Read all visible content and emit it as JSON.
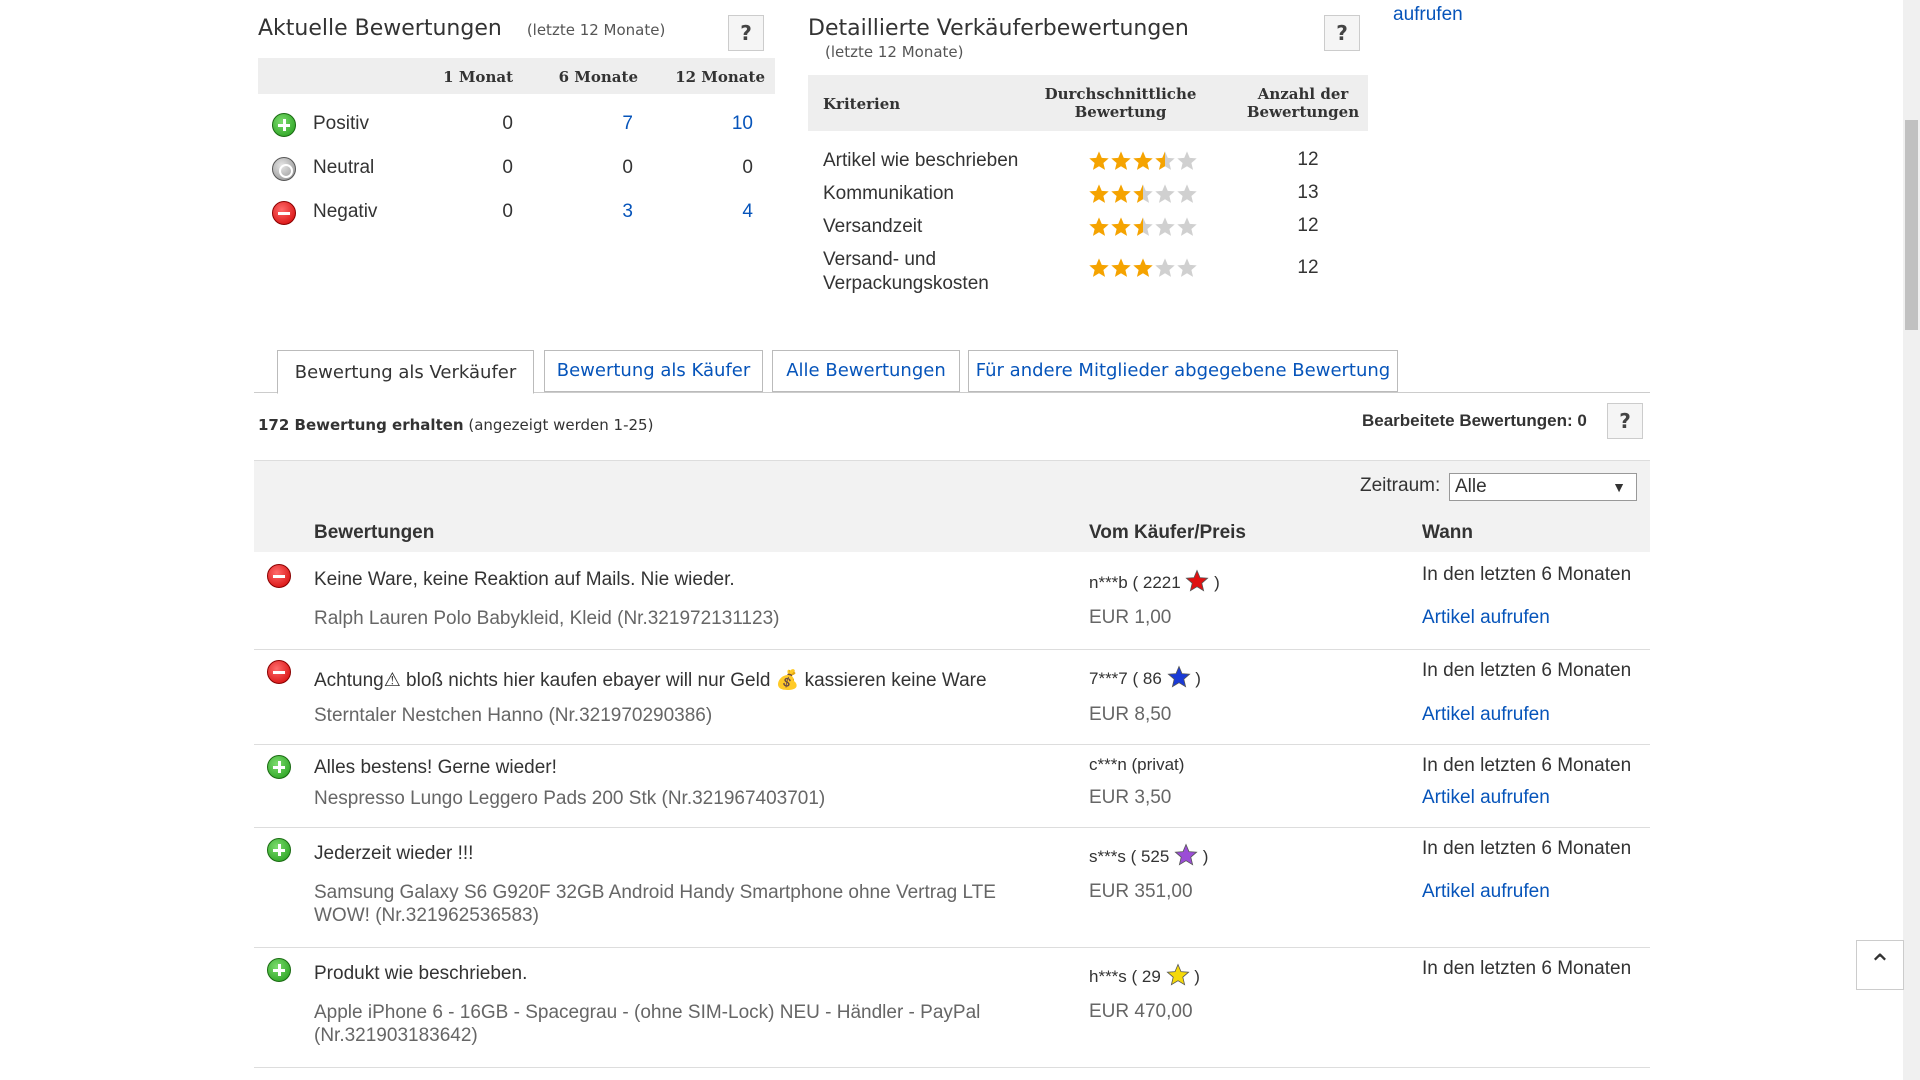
{
  "top_link": "aufrufen",
  "recent": {
    "title": "Aktuelle Bewertungen",
    "subtitle": "(letzte 12 Monate)",
    "columns": [
      "1 Monat",
      "6 Monate",
      "12 Monate"
    ],
    "rows": [
      {
        "label": "Positiv",
        "values": [
          "0",
          "7",
          "10"
        ],
        "type": "positive"
      },
      {
        "label": "Neutral",
        "values": [
          "0",
          "0",
          "0"
        ],
        "type": "neutral"
      },
      {
        "label": "Negativ",
        "values": [
          "0",
          "3",
          "4"
        ],
        "type": "negative"
      }
    ],
    "help": "?"
  },
  "detail": {
    "title": "Detaillierte Verkäuferbewertungen",
    "subtitle": "(letzte 12 Monate)",
    "head_criteria": "Kriterien",
    "head_avg": "Durchschnittliche Bewertung",
    "head_count": "Anzahl der Bewertungen",
    "rows": [
      {
        "label": "Artikel wie beschrieben",
        "rating": 3.5,
        "count": "12"
      },
      {
        "label": "Kommunikation",
        "rating": 2.5,
        "count": "13"
      },
      {
        "label": "Versandzeit",
        "rating": 2.5,
        "count": "12"
      },
      {
        "label": "Versand- und Verpackungskosten",
        "rating": 3,
        "count": "12"
      }
    ],
    "help": "?"
  },
  "tabs": [
    {
      "label": "Bewertung als Verkäufer",
      "active": true
    },
    {
      "label": "Bewertung als Käufer",
      "active": false
    },
    {
      "label": "Alle Bewertungen",
      "active": false
    },
    {
      "label": "Für andere Mitglieder abgegebene Bewertung",
      "active": false
    }
  ],
  "summary": {
    "count_text": "172 Bewertung erhalten",
    "range_text": "(angezeigt werden 1-25)"
  },
  "edited": {
    "label": "Bearbeitete Bewertungen: 0",
    "help": "?"
  },
  "filter": {
    "label": "Zeitraum:",
    "selected": "Alle"
  },
  "columns": {
    "feedback": "Bewertungen",
    "buyer": "Vom Käufer/Preis",
    "when": "Wann"
  },
  "feedback": [
    {
      "type": "negative",
      "comment": "Keine Ware, keine Reaktion auf Mails. Nie wieder.",
      "item": "Ralph Lauren Polo Babykleid, Kleid (Nr.321972131123)",
      "buyer": "n***b ( 2221",
      "star_color": "#e01010",
      "buyer_end": ")",
      "price": "EUR 1,00",
      "when": "In den letzten 6 Monaten",
      "view": "Artikel aufrufen"
    },
    {
      "type": "negative",
      "comment": "Achtung⚠ bloß nichts hier kaufen ebayer will nur Geld 💰 kassieren keine Ware",
      "item": "Sterntaler Nestchen Hanno (Nr.321970290386)",
      "buyer": "7***7 ( 86",
      "star_color": "#1a3ad6",
      "buyer_end": ")",
      "price": "EUR 8,50",
      "when": "In den letzten 6 Monaten",
      "view": "Artikel aufrufen"
    },
    {
      "type": "positive",
      "comment": "Alles bestens! Gerne wieder!",
      "item": "Nespresso Lungo Leggero Pads 200 Stk (Nr.321967403701)",
      "buyer": "c***n (privat)",
      "star_color": "",
      "buyer_end": "",
      "price": "EUR 3,50",
      "when": "In den letzten 6 Monaten",
      "view": "Artikel aufrufen"
    },
    {
      "type": "positive",
      "comment": "Jederzeit wieder !!!",
      "item": "Samsung Galaxy S6 G920F 32GB Android Handy Smartphone ohne Vertrag LTE WOW! (Nr.321962536583)",
      "buyer": "s***s ( 525",
      "star_color": "#9b4dd6",
      "buyer_end": ")",
      "price": "EUR 351,00",
      "when": "In den letzten 6 Monaten",
      "view": "Artikel aufrufen"
    },
    {
      "type": "positive",
      "comment": "Produkt wie beschrieben.",
      "item": "Apple iPhone 6 - 16GB - Spacegrau - (ohne SIM-Lock) NEU - Händler - PayPal (Nr.321903183642)",
      "buyer": "h***s ( 29",
      "star_color": "#f5d90a",
      "buyer_end": ")",
      "price": "EUR 470,00",
      "when": "In den letzten 6 Monaten",
      "view": ""
    }
  ]
}
